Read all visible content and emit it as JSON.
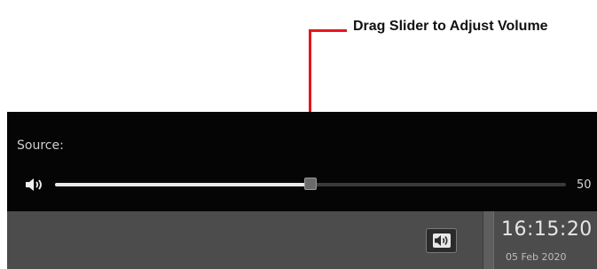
{
  "annotation": {
    "text": "Drag Slider to Adjust Volume",
    "color": "#e8141c"
  },
  "volume_panel": {
    "source_label": "Source:",
    "volume_value": "50",
    "volume_fraction": 0.5
  },
  "icons": {
    "speaker": "speaker-icon",
    "volume_button": "volume-button-icon"
  },
  "bottom_bar": {
    "time": "16:15:20",
    "date": "05 Feb 2020"
  }
}
